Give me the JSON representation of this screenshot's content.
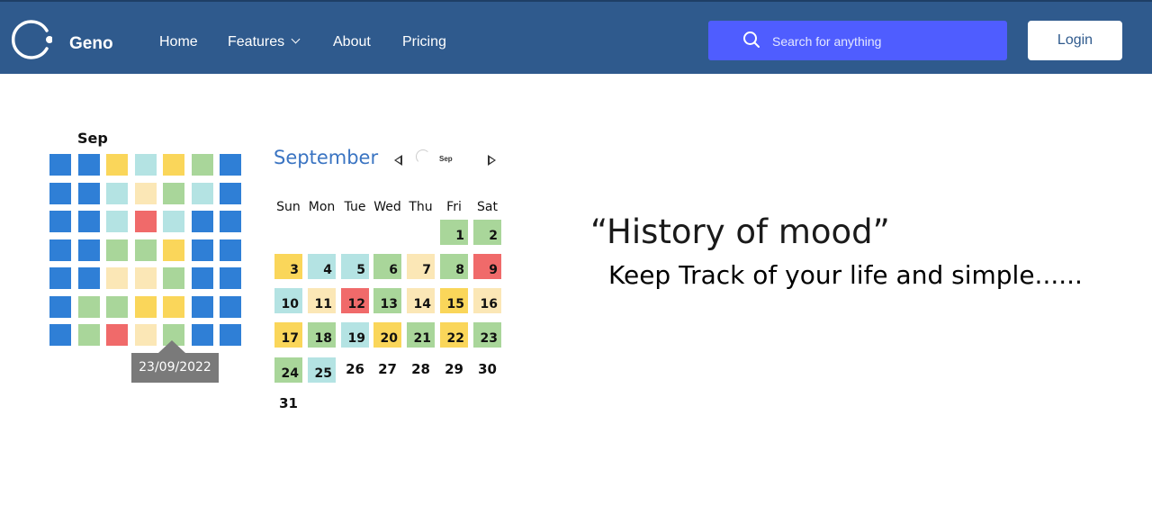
{
  "nav": {
    "brand": "Geno",
    "links": [
      "Home",
      "Features",
      "About",
      "Pricing"
    ],
    "search_placeholder": "Search for anything",
    "login_label": "Login"
  },
  "mood_colors": {
    "blue": "#2f7fd6",
    "yellow": "#fad65a",
    "teal": "#b4e3e3",
    "cream": "#fbe7b6",
    "green": "#a9d69a",
    "red": "#f06a6a"
  },
  "mini_calendar": {
    "month": "Sep",
    "rows": [
      [
        "blue",
        "blue",
        "yellow",
        "teal",
        "yellow",
        "green",
        "blue"
      ],
      [
        "blue",
        "blue",
        "teal",
        "cream",
        "green",
        "teal",
        "blue"
      ],
      [
        "blue",
        "blue",
        "teal",
        "red",
        "teal",
        "blue",
        "blue"
      ],
      [
        "blue",
        "blue",
        "green",
        "green",
        "yellow",
        "blue",
        "blue"
      ],
      [
        "blue",
        "blue",
        "cream",
        "cream",
        "green",
        "blue",
        "blue"
      ],
      [
        "blue",
        "green",
        "green",
        "yellow",
        "yellow",
        "blue",
        "blue"
      ],
      [
        "blue",
        "green",
        "red",
        "cream",
        "green",
        "blue",
        "blue"
      ]
    ],
    "tooltip": "23/09/2022"
  },
  "month_calendar": {
    "title": "September",
    "small_label": "Sep",
    "weekdays": [
      "Sun",
      "Mon",
      "Tue",
      "Wed",
      "Thu",
      "Fri",
      "Sat"
    ],
    "days": [
      {
        "n": "1",
        "mood": "green"
      },
      {
        "n": "2",
        "mood": "green"
      },
      {
        "n": "3",
        "mood": "yellow"
      },
      {
        "n": "4",
        "mood": "teal"
      },
      {
        "n": "5",
        "mood": "teal"
      },
      {
        "n": "6",
        "mood": "green"
      },
      {
        "n": "7",
        "mood": "cream"
      },
      {
        "n": "8",
        "mood": "green"
      },
      {
        "n": "9",
        "mood": "red"
      },
      {
        "n": "10",
        "mood": "teal"
      },
      {
        "n": "11",
        "mood": "cream"
      },
      {
        "n": "12",
        "mood": "red"
      },
      {
        "n": "13",
        "mood": "green"
      },
      {
        "n": "14",
        "mood": "cream"
      },
      {
        "n": "15",
        "mood": "yellow"
      },
      {
        "n": "16",
        "mood": "cream"
      },
      {
        "n": "17",
        "mood": "yellow"
      },
      {
        "n": "18",
        "mood": "green"
      },
      {
        "n": "19",
        "mood": "teal"
      },
      {
        "n": "20",
        "mood": "yellow"
      },
      {
        "n": "21",
        "mood": "green"
      },
      {
        "n": "22",
        "mood": "yellow"
      },
      {
        "n": "23",
        "mood": "green"
      },
      {
        "n": "24",
        "mood": "green"
      },
      {
        "n": "25",
        "mood": "teal"
      },
      {
        "n": "26",
        "mood": ""
      },
      {
        "n": "27",
        "mood": ""
      },
      {
        "n": "28",
        "mood": ""
      },
      {
        "n": "29",
        "mood": ""
      },
      {
        "n": "30",
        "mood": ""
      },
      {
        "n": "31",
        "mood": ""
      }
    ]
  },
  "hero": {
    "heading": "“History of mood”",
    "subheading": "Keep Track of your life and simple......"
  }
}
